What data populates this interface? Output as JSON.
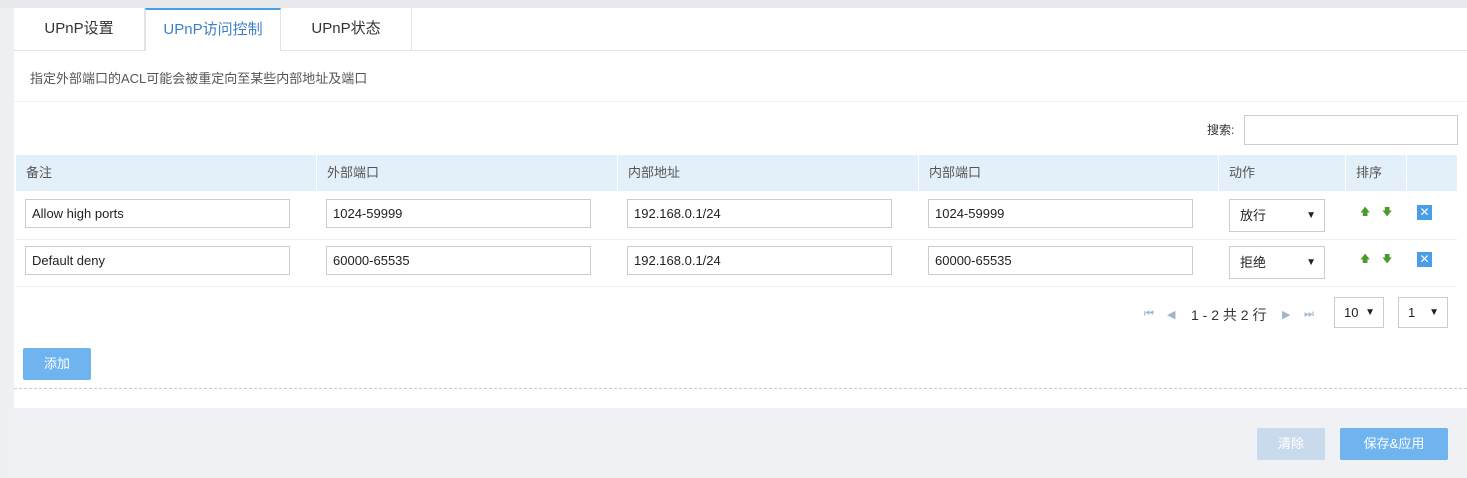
{
  "tabs": [
    {
      "label": "UPnP设置"
    },
    {
      "label": "UPnP访问控制"
    },
    {
      "label": "UPnP状态"
    }
  ],
  "description": "指定外部端口的ACL可能会被重定向至某些内部地址及端口",
  "search": {
    "label": "搜索:",
    "value": ""
  },
  "table": {
    "columns": [
      "备注",
      "外部端口",
      "内部地址",
      "内部端口",
      "动作",
      "排序",
      ""
    ],
    "rows": [
      {
        "comment": "Allow high ports",
        "ext_port": "1024-59999",
        "int_addr": "192.168.0.1/24",
        "int_port": "1024-59999",
        "action": "放行"
      },
      {
        "comment": "Default deny",
        "ext_port": "60000-65535",
        "int_addr": "192.168.0.1/24",
        "int_port": "60000-65535",
        "action": "拒绝"
      }
    ]
  },
  "pagination": {
    "summary": "1 - 2 共 2 行",
    "page_size": "10",
    "page": "1"
  },
  "buttons": {
    "add": "添加",
    "clear": "清除",
    "save": "保存&应用"
  },
  "icons": {
    "up": "arrow-up-icon",
    "down": "arrow-down-icon",
    "delete": "close-icon"
  },
  "colors": {
    "accent": "#4a9ee5",
    "header_bg": "#e3eff9",
    "button": "#6fb4ee"
  }
}
